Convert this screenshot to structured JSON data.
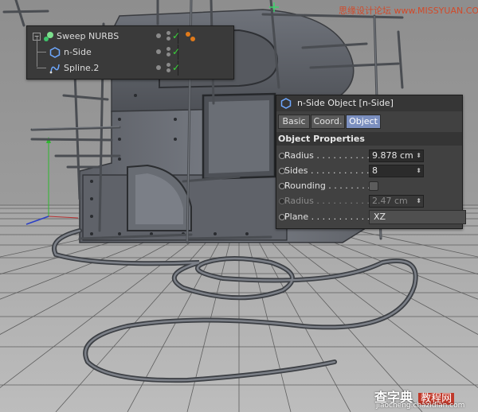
{
  "watermark_top": "思缘设计论坛 www.MISSYUAN.COM",
  "watermark_bottom": {
    "logo_text": "查字典",
    "logo_box": "教程网",
    "url": "jiaocheng.chazidian.com"
  },
  "object_manager": {
    "rows": [
      {
        "label": "Sweep NURBS",
        "icon": "sweep-nurbs-icon"
      },
      {
        "label": "n-Side",
        "icon": "nside-icon"
      },
      {
        "label": "Spline.2",
        "icon": "spline-icon"
      }
    ],
    "expand_symbol": "−"
  },
  "attribute_manager": {
    "title": "n-Side Object [n-Side]",
    "tabs": [
      "Basic",
      "Coord.",
      "Object"
    ],
    "active_tab": "Object",
    "section": "Object Properties",
    "properties": [
      {
        "label": "Radius . . . . . . . . . .",
        "value": "9.878 cm",
        "type": "spinner"
      },
      {
        "label": "Sides . . . . . . . . . . .",
        "value": "8",
        "type": "spinner"
      },
      {
        "label": "Rounding . . . . . . . .",
        "value": "",
        "type": "checkbox"
      },
      {
        "label": "Radius . . . . . . . . . .",
        "value": "2.47 cm",
        "type": "spinner",
        "disabled": true
      },
      {
        "label": "Plane . . . . . . . . . . .",
        "value": "XZ",
        "type": "dropdown"
      }
    ],
    "spinner_glyph": "⬍"
  },
  "colors": {
    "accent_tab": "#7b8fbf",
    "check_green": "#39d439",
    "panel_bg": "#3a3a3a"
  }
}
